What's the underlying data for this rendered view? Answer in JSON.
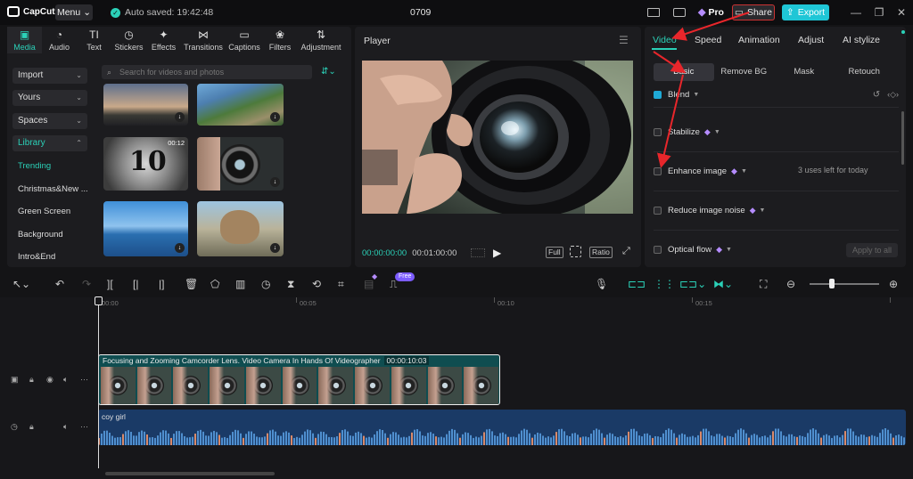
{
  "app": {
    "logo_text": "CapCut",
    "menu_label": "Menu",
    "autosave_text": "Auto saved: 19:42:48",
    "project_title": "0709",
    "pro_label": "Pro",
    "share_label": "Share",
    "export_label": "Export",
    "accent_color": "#2bd1b8"
  },
  "media_tabs": [
    {
      "label": "Media",
      "icon": "media-icon",
      "glyph": "▣",
      "active": true
    },
    {
      "label": "Audio",
      "icon": "audio-icon",
      "glyph": "◔"
    },
    {
      "label": "Text",
      "icon": "text-icon",
      "glyph": "TI"
    },
    {
      "label": "Stickers",
      "icon": "stickers-icon",
      "glyph": "◷"
    },
    {
      "label": "Effects",
      "icon": "effects-icon",
      "glyph": "✦"
    },
    {
      "label": "Transitions",
      "icon": "transitions-icon",
      "glyph": "⋈"
    },
    {
      "label": "Captions",
      "icon": "captions-icon",
      "glyph": "▭"
    },
    {
      "label": "Filters",
      "icon": "filters-icon",
      "glyph": "❀"
    },
    {
      "label": "Adjustment",
      "icon": "adjustment-icon",
      "glyph": "⇅"
    }
  ],
  "media_side": {
    "import": "Import",
    "yours": "Yours",
    "spaces": "Spaces",
    "library": "Library",
    "sub": [
      "Trending",
      "Christmas&New ...",
      "Green Screen",
      "Background",
      "Intro&End"
    ]
  },
  "search": {
    "placeholder": "Search for videos and photos"
  },
  "thumbs": {
    "duration_label": "00:12",
    "counter_text": "10"
  },
  "player": {
    "label": "Player",
    "current_time": "00:00:00:00",
    "total_time": "00:01:00:00",
    "full_label": "Full",
    "ratio_label": "Ratio"
  },
  "inspector": {
    "tabs": [
      "Video",
      "Speed",
      "Animation",
      "Adjust",
      "AI stylize"
    ],
    "sub_tabs": [
      "Basic",
      "Remove BG",
      "Mask",
      "Retouch"
    ],
    "options": [
      {
        "label": "Blend",
        "checked": true
      },
      {
        "label": "Stabilize",
        "checked": false,
        "pro": true
      },
      {
        "label": "Enhance image",
        "checked": false,
        "pro": true
      },
      {
        "label": "Reduce image noise",
        "checked": false,
        "pro": true
      },
      {
        "label": "Optical flow",
        "checked": false,
        "pro": true
      }
    ],
    "uses_left": "3 uses left for today",
    "apply_all": "Apply to all"
  },
  "toolbar": {
    "free_badge": "Free"
  },
  "timeline": {
    "ruler": [
      "00:00",
      "00:05",
      "00:10",
      "00:15"
    ],
    "video_clip_title": "Focusing and Zooming Camcorder Lens. Video Camera In Hands Of Videographer",
    "video_clip_duration": "00:00:10:03",
    "audio_clip_title": "coy girl"
  }
}
